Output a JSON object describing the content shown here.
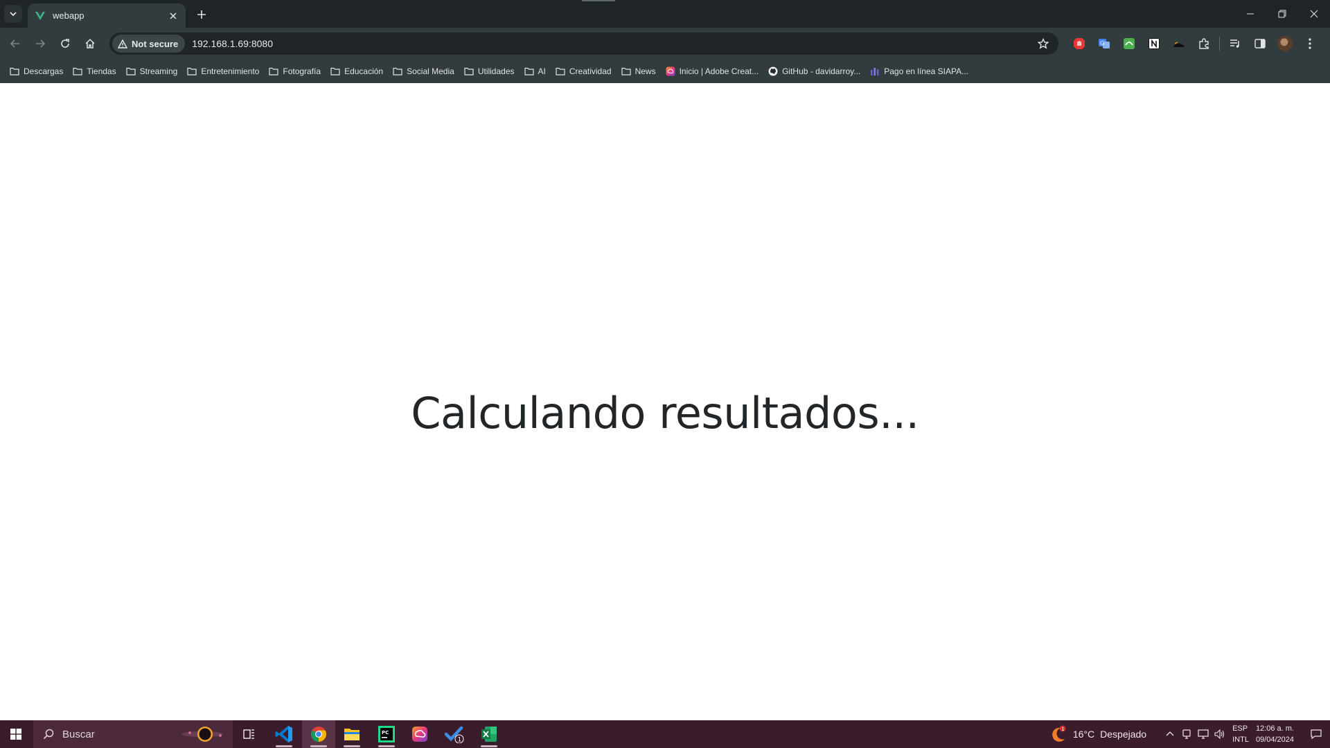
{
  "browser": {
    "tab": {
      "title": "webapp",
      "favicon": "vue-logo-icon"
    },
    "address_bar": {
      "security_label": "Not secure",
      "url": "192.168.1.69:8080"
    },
    "bookmarks": [
      {
        "label": "Descargas",
        "icon": "folder-icon"
      },
      {
        "label": "Tiendas",
        "icon": "folder-icon"
      },
      {
        "label": "Streaming",
        "icon": "folder-icon"
      },
      {
        "label": "Entretenimiento",
        "icon": "folder-icon"
      },
      {
        "label": "Fotografía",
        "icon": "folder-icon"
      },
      {
        "label": "Educación",
        "icon": "folder-icon"
      },
      {
        "label": "Social Media",
        "icon": "folder-icon"
      },
      {
        "label": "Utilidades",
        "icon": "folder-icon"
      },
      {
        "label": "AI",
        "icon": "folder-icon"
      },
      {
        "label": "Creatividad",
        "icon": "folder-icon"
      },
      {
        "label": "News",
        "icon": "folder-icon"
      },
      {
        "label": "Inicio | Adobe Creat...",
        "icon": "adobe-cc-icon"
      },
      {
        "label": "GitHub - davidarroy...",
        "icon": "github-icon"
      },
      {
        "label": "Pago en línea SIAPA...",
        "icon": "siapa-icon"
      }
    ]
  },
  "page": {
    "message": "Calculando resultados..."
  },
  "taskbar": {
    "search_placeholder": "Buscar",
    "apps": [
      "task-view",
      "vscode",
      "chrome",
      "file-explorer",
      "pycharm",
      "creative-cloud",
      "todo",
      "excel"
    ],
    "todo_badge": "1",
    "weather": {
      "temperature": "16°C",
      "condition": "Despejado",
      "alert_badge": "1"
    },
    "language": {
      "line1": "ESP",
      "line2": "INTL"
    },
    "clock": {
      "time": "12:06 a. m.",
      "date": "09/04/2024"
    }
  },
  "colors": {
    "chrome_frame": "#1f2527",
    "chrome_toolbar": "#323b3e",
    "taskbar": "#3b1c2c",
    "page_text": "#222629"
  }
}
